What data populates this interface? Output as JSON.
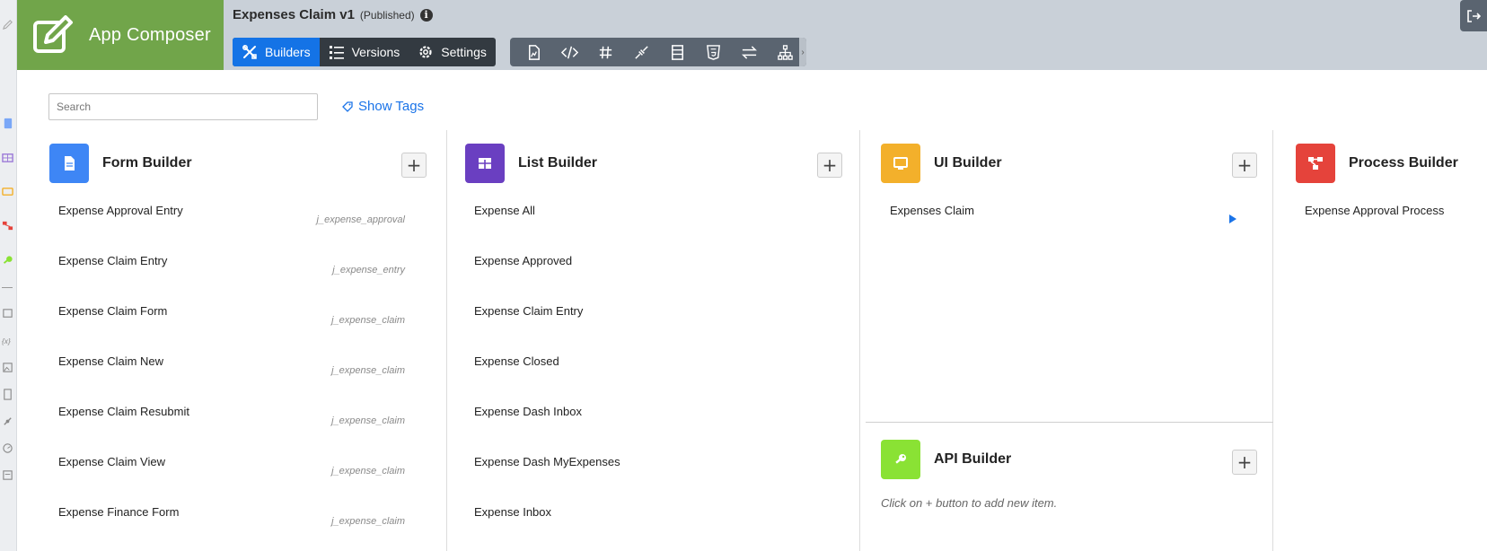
{
  "header": {
    "brand_label": "App Composer",
    "app_name": "Expenses Claim v1",
    "app_status": "(Published)",
    "info_glyph": "i",
    "tabs": [
      {
        "label": "Builders",
        "icon": "tools-icon"
      },
      {
        "label": "Versions",
        "icon": "list-icon"
      },
      {
        "label": "Settings",
        "icon": "gear-icon"
      }
    ],
    "toolbar_icons": [
      "chart-file-icon",
      "code-icon",
      "hash-icon",
      "plug-icon",
      "table-icon",
      "html5-icon",
      "exchange-icon",
      "sitemap-icon"
    ],
    "more_glyph": "›"
  },
  "search": {
    "placeholder": "Search",
    "value": ""
  },
  "show_tags_label": "Show Tags",
  "add_glyph": "+",
  "colors": {
    "brand": "#71a54a",
    "header_bg": "#c9d0d8",
    "accent": "#1473e6",
    "form_builder": "#3e86f5",
    "list_builder": "#6a3fc1",
    "ui_builder": "#f3b02b",
    "process_builder": "#e5433b",
    "api_builder": "#8ae234"
  },
  "form_builder": {
    "title": "Form Builder",
    "items": [
      {
        "label": "Expense Approval Entry",
        "tag": "j_expense_approval"
      },
      {
        "label": "Expense Claim Entry",
        "tag": "j_expense_entry"
      },
      {
        "label": "Expense Claim Form",
        "tag": "j_expense_claim"
      },
      {
        "label": "Expense Claim New",
        "tag": "j_expense_claim"
      },
      {
        "label": "Expense Claim Resubmit",
        "tag": "j_expense_claim"
      },
      {
        "label": "Expense Claim View",
        "tag": "j_expense_claim"
      },
      {
        "label": "Expense Finance Form",
        "tag": "j_expense_claim"
      }
    ]
  },
  "list_builder": {
    "title": "List Builder",
    "items": [
      {
        "label": "Expense All"
      },
      {
        "label": "Expense Approved"
      },
      {
        "label": "Expense Claim Entry"
      },
      {
        "label": "Expense Closed"
      },
      {
        "label": "Expense Dash Inbox"
      },
      {
        "label": "Expense Dash MyExpenses"
      },
      {
        "label": "Expense Inbox"
      }
    ]
  },
  "ui_builder": {
    "title": "UI Builder",
    "items": [
      {
        "label": "Expenses Claim"
      }
    ]
  },
  "api_builder": {
    "title": "API Builder",
    "hint_before": "Click on",
    "hint_after": "button to add new item."
  },
  "process_builder": {
    "title": "Process Builder",
    "items": [
      {
        "label": "Expense Approval Process"
      }
    ]
  }
}
